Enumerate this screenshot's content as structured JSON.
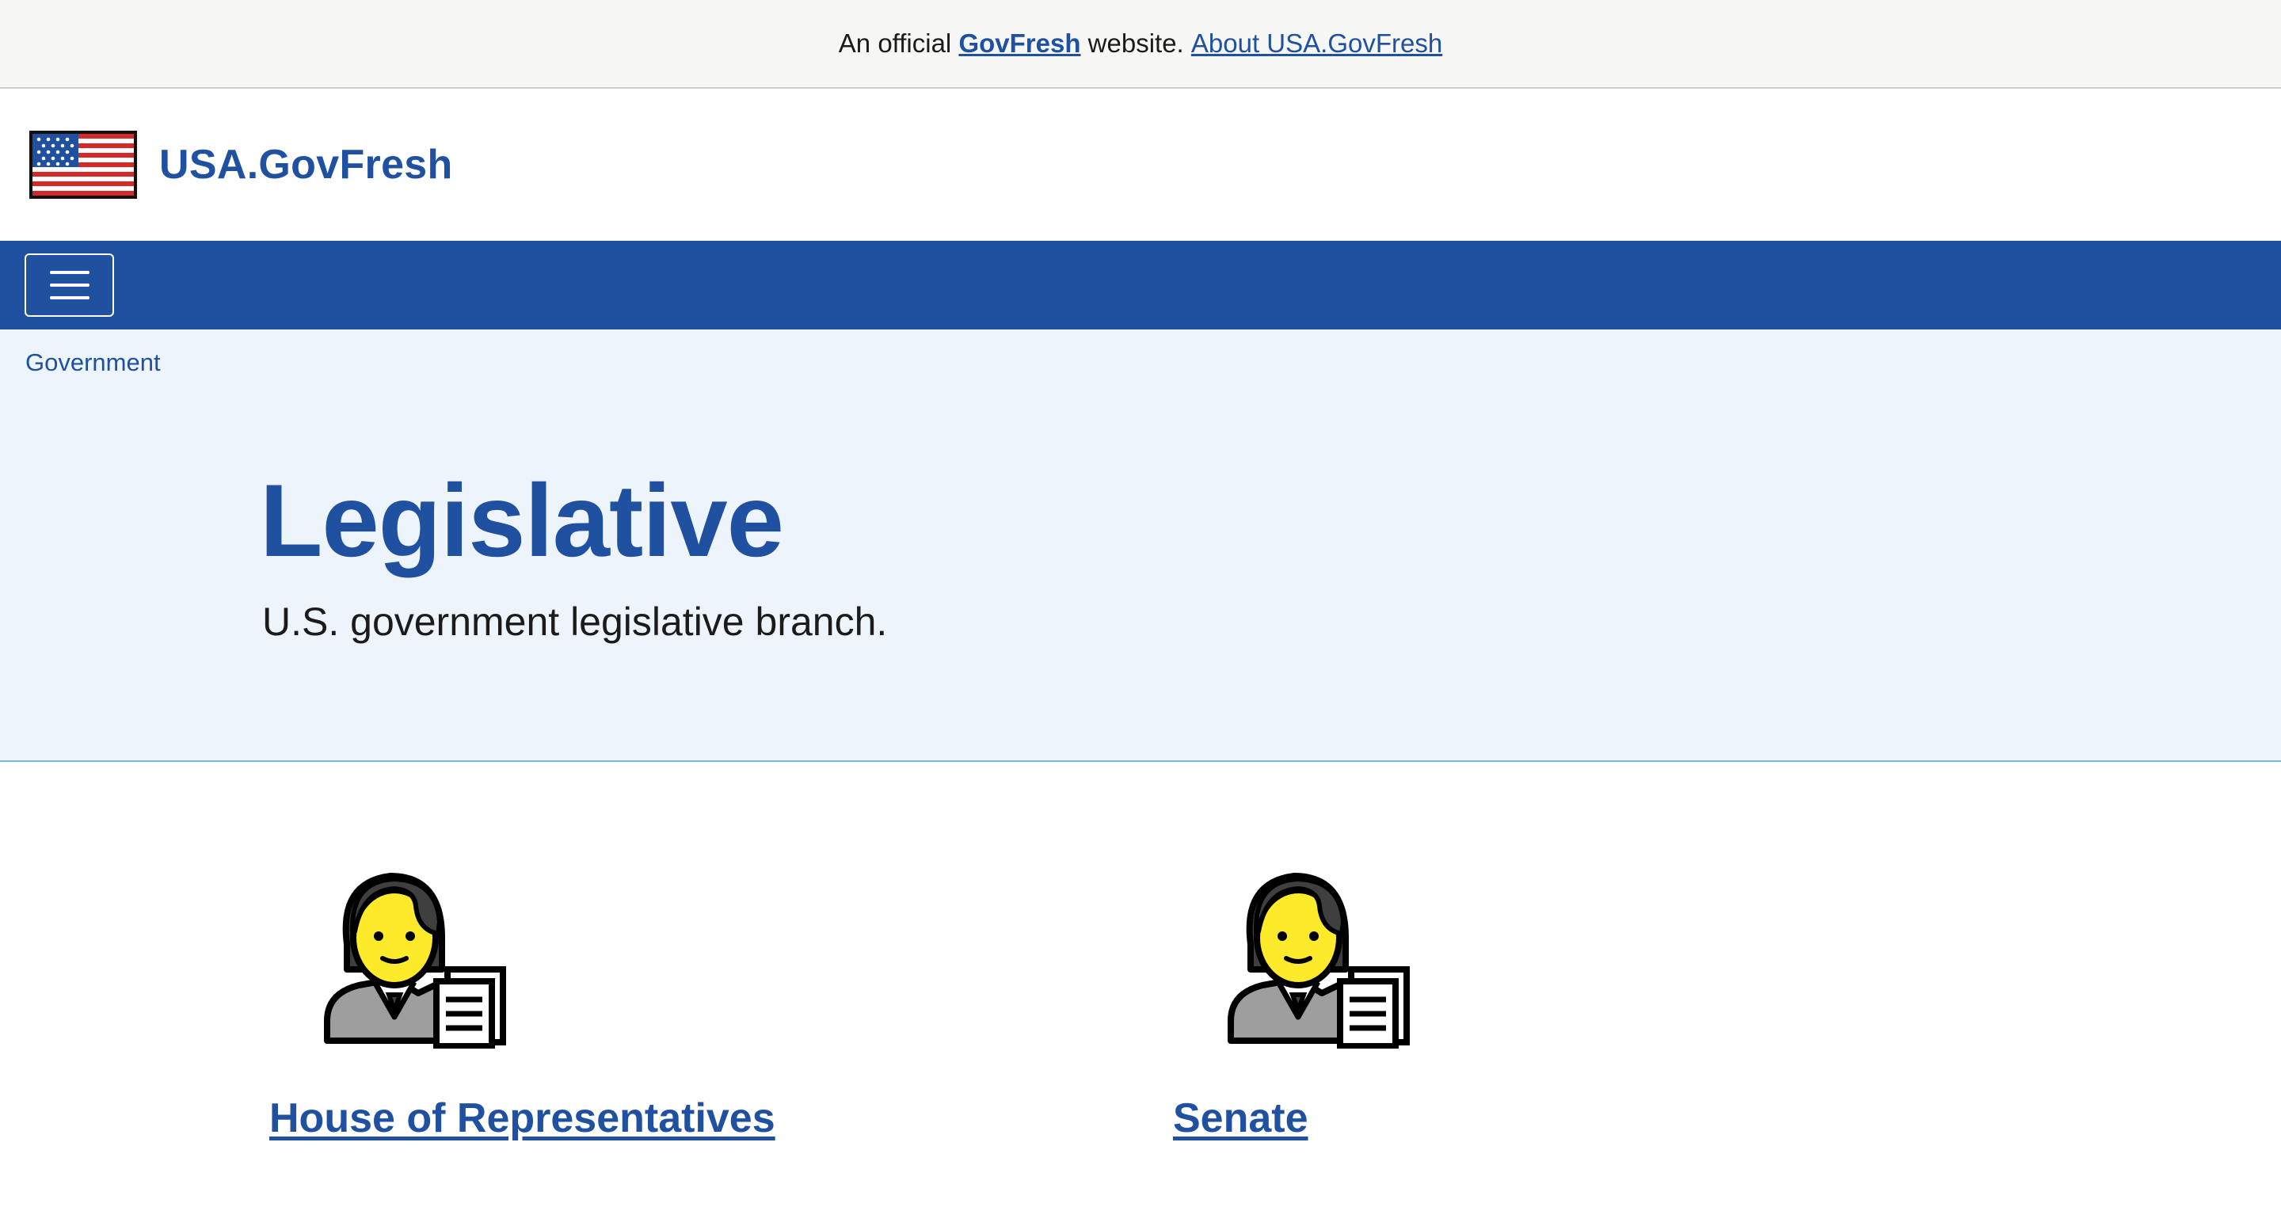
{
  "banner": {
    "prefix": "An official",
    "brand": "GovFresh",
    "suffix": "website.",
    "about_link": "About USA.GovFresh"
  },
  "header": {
    "logo_icon": "us-flag-icon",
    "site_title": "USA.GovFresh"
  },
  "navbar": {
    "menu_icon": "hamburger-menu-icon"
  },
  "breadcrumb": {
    "label": "Government"
  },
  "hero": {
    "title": "Legislative",
    "subtitle": "U.S. government legislative branch."
  },
  "cards": [
    {
      "icon": "office-worker-icon",
      "label": "House of Representatives"
    },
    {
      "icon": "office-worker-icon",
      "label": "Senate"
    }
  ],
  "colors": {
    "brand_blue": "#1f51a0",
    "hero_bg": "#edf4fb",
    "banner_bg": "#f7f7f5"
  }
}
